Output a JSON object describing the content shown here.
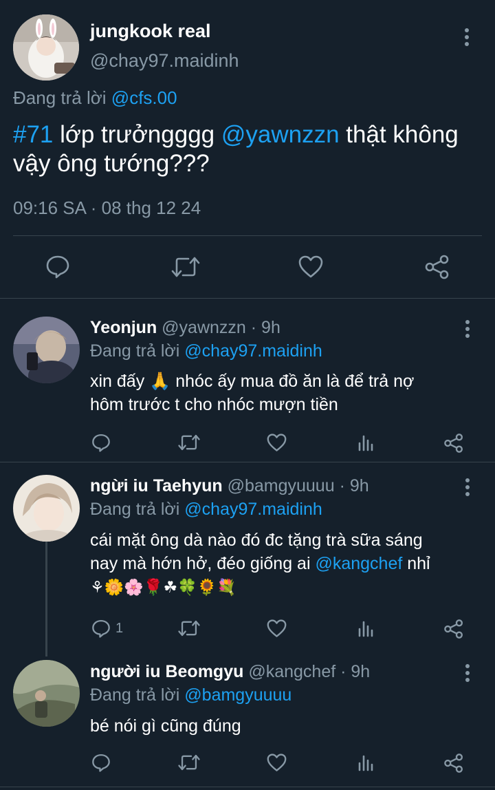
{
  "main_tweet": {
    "display_name": "jungkook real",
    "handle": "@chay97.maidinh",
    "replying_prefix": "Đang trả lời",
    "replying_to": "@cfs.00",
    "text_hashtag": "#71",
    "text_part1": " lớp trưởngggg ",
    "text_mention": "@yawnzzn",
    "text_part2": " thật không vậy ông tướng???",
    "timestamp": "09:16 SA · 08 thg 12 24"
  },
  "replies": [
    {
      "display_name": "Yeonjun",
      "meta": " @yawnzzn · 9h",
      "replying_prefix": "Đang trả lời ",
      "replying_to": "@chay97.maidinh",
      "text_line1": "xin đấy 🙏 nhóc ấy mua đồ ăn là để trả nợ",
      "text_line2": "hôm trước t cho nhóc mượn tiền",
      "reply_count": ""
    },
    {
      "display_name": "ngừi iu Taehyun",
      "meta": " @bamgyuuuu · 9h",
      "replying_prefix": "Đang trả lời ",
      "replying_to": "@chay97.maidinh",
      "text_line1": "cái mặt ông dà nào đó đc tặng trà sữa sáng",
      "text_line2a": "nay mà hớn hở, đéo giống ai ",
      "text_mention": "@kangchef",
      "text_line2b": " nhỉ",
      "text_line3": "⚘🌼🌸🌹☘🍀🌻💐",
      "reply_count": "1"
    },
    {
      "display_name": "người iu Beomgyu",
      "meta": " @kangchef · 9h",
      "replying_prefix": "Đang trả lời ",
      "replying_to": "@bamgyuuuu",
      "text_line1": "bé nói gì cũng đúng",
      "reply_count": ""
    }
  ],
  "icons": {
    "reply": "reply-icon",
    "retweet": "retweet-icon",
    "like": "heart-icon",
    "analytics": "analytics-icon",
    "share": "share-icon",
    "more": "more-vertical-icon"
  },
  "colors": {
    "background": "#15202b",
    "accent": "#1da1f2",
    "secondary_text": "#8899a6",
    "divider": "#38444d"
  }
}
